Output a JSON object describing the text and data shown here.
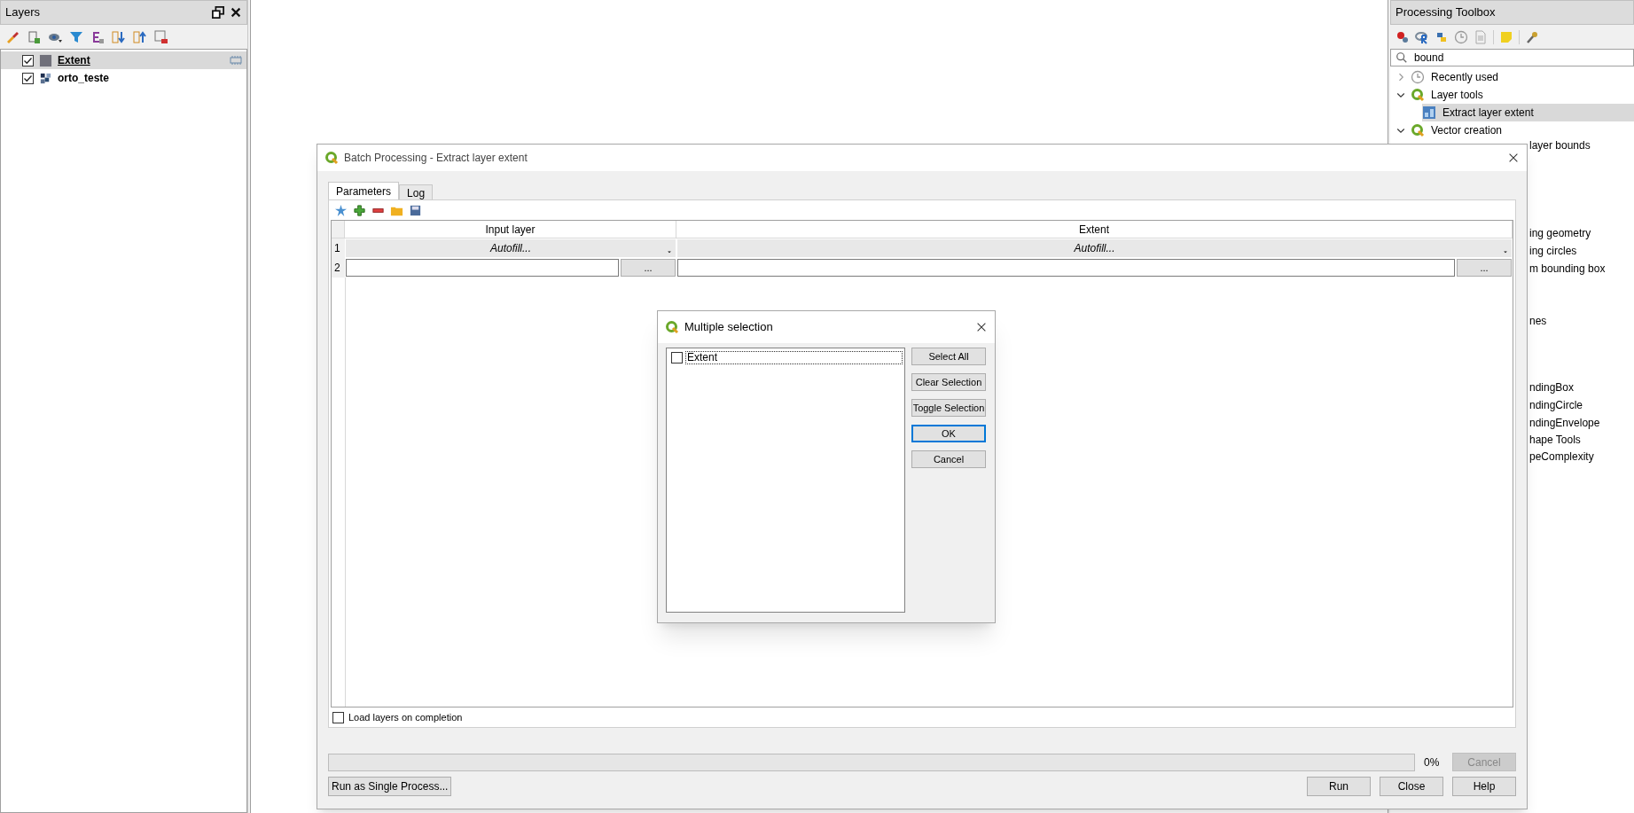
{
  "layers_panel": {
    "title": "Layers",
    "layers": [
      {
        "name": "Extent",
        "kind": "vector",
        "checked": true,
        "selected": true
      },
      {
        "name": "orto_teste",
        "kind": "raster",
        "checked": true,
        "selected": false
      }
    ]
  },
  "processing_toolbox": {
    "title": "Processing Toolbox",
    "search": {
      "value": "bound"
    },
    "tree": [
      {
        "label": "Recently used",
        "kind": "history",
        "expanded": false,
        "selected": false
      },
      {
        "label": "Layer tools",
        "kind": "provider",
        "expanded": true,
        "selected": false,
        "children": [
          {
            "label": "Extract layer extent",
            "kind": "algorithm",
            "selected": true
          }
        ]
      },
      {
        "label": "Vector creation",
        "kind": "provider",
        "expanded": true,
        "selected": false
      }
    ],
    "partly_covered_items": [
      "layer bounds",
      "ing geometry",
      "ing circles",
      "m bounding box",
      "nes",
      "ndingBox",
      "ndingCircle",
      "ndingEnvelope",
      "hape Tools",
      "peComplexity"
    ]
  },
  "batch_dialog": {
    "title": "Batch Processing - Extract layer extent",
    "tabs": [
      {
        "label": "Parameters",
        "selected": true
      },
      {
        "label": "Log",
        "selected": false
      }
    ],
    "table": {
      "columns": [
        "Input layer",
        "Extent"
      ],
      "rows": [
        {
          "number": "1",
          "kind": "autofill",
          "cells": [
            "Autofill...",
            "Autofill..."
          ]
        },
        {
          "number": "2",
          "kind": "input",
          "cells": [
            "...",
            "..."
          ]
        }
      ]
    },
    "load_layers": {
      "label": "Load layers on completion",
      "checked": false
    },
    "progress": {
      "level": 0,
      "reading": "0%"
    },
    "cancel_button": {
      "label": "Cancel",
      "disabled": true
    },
    "left_buttons": [
      "Run as Single Process..."
    ],
    "right_buttons": [
      "Run",
      "Close",
      "Help"
    ]
  },
  "multiple_selection_dialog": {
    "title": "Multiple selection",
    "items": [
      {
        "label": "Extent",
        "checked": false
      }
    ],
    "buttons": [
      {
        "label": "Select All",
        "default": false
      },
      {
        "label": "Clear Selection",
        "default": false
      },
      {
        "label": "Toggle Selection",
        "default": false
      },
      {
        "label": "OK",
        "default": true
      },
      {
        "label": "Cancel",
        "default": false
      }
    ]
  }
}
